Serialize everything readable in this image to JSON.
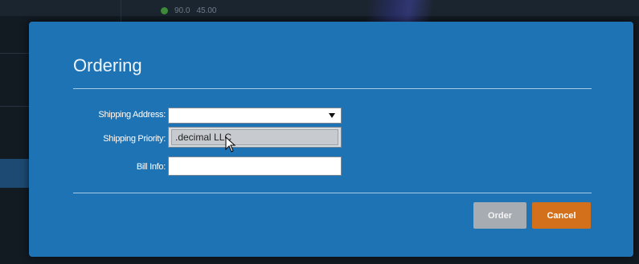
{
  "background": {
    "status_value_1": "90.0",
    "status_value_2": "45.00"
  },
  "modal": {
    "title": "Ordering",
    "fields": {
      "shipping_address_label": "Shipping Address:",
      "shipping_address_value": "",
      "shipping_priority_label": "Shipping Priority:",
      "bill_info_label": "Bill Info:",
      "bill_info_value": ""
    },
    "dropdown": {
      "open": true,
      "options": [
        ".decimal LLC"
      ]
    },
    "buttons": {
      "order_label": "Order",
      "order_enabled": false,
      "cancel_label": "Cancel"
    }
  },
  "colors": {
    "modal_bg": "#1e73b5",
    "cancel_button": "#d2701b",
    "order_button_disabled": "#a6acb1",
    "status_dot": "#3c8a3a"
  },
  "icons": {
    "select_arrow": "chevron-down-icon",
    "pointer": "mouse-pointer-icon"
  }
}
